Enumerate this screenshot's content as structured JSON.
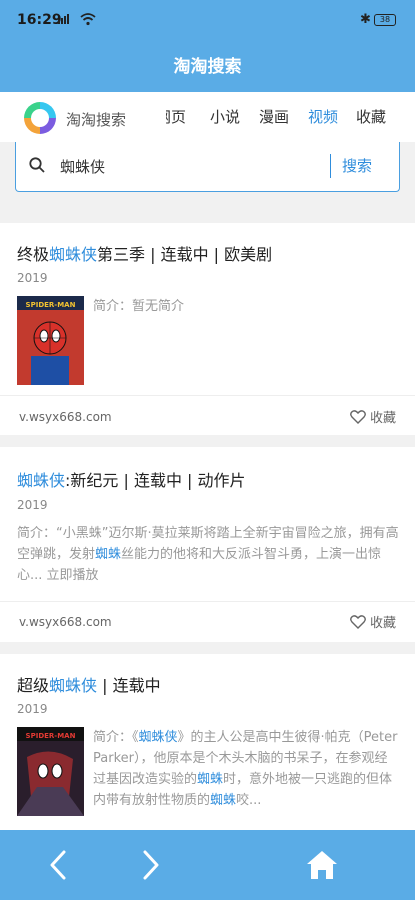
{
  "status_bar": {
    "time": "16:29",
    "battery": "38"
  },
  "header": {
    "title": "淘淘搜索"
  },
  "nav": {
    "logo_text": "淘淘搜索",
    "tabs": [
      {
        "label": "网页",
        "active": false
      },
      {
        "label": "小说",
        "active": false
      },
      {
        "label": "漫画",
        "active": false
      },
      {
        "label": "视频",
        "active": true
      },
      {
        "label": "收藏",
        "active": false
      }
    ]
  },
  "search": {
    "value": "蜘蛛侠",
    "button_label": "搜索"
  },
  "results": [
    {
      "title_hl": "终极",
      "title_key": "蜘蛛侠",
      "title_rest": "第三季 | 连载中 | 欧美剧",
      "year": "2019",
      "desc_a": "简介：暂无简介",
      "source": "v.wsyx668.com",
      "fav_label": "收藏"
    },
    {
      "title_key": "蜘蛛侠",
      "title_rest": ":新纪元 | 连载中 | 动作片",
      "year": "2019",
      "desc_a": "简介：“小黑蛛”迈尔斯·莫拉莱斯将踏上全新宇宙冒险之旅，拥有高空弹跳，发射",
      "desc_b": "蜘蛛",
      "desc_c": "丝能力的他将和大反派斗智斗勇，上演一出惊心... 立即播放",
      "source": "v.wsyx668.com",
      "fav_label": "收藏"
    },
    {
      "title_hl": "超级",
      "title_key": "蜘蛛侠",
      "title_rest": " | 连载中",
      "year": "2019",
      "desc_a": "简介：《",
      "desc_b": "蜘蛛侠",
      "desc_c": "》的主人公是高中生彼得·帕克（Peter Parker），他原本是个木头木脑的书呆子，在参观经过基因改造实验的",
      "desc_d": "蜘蛛",
      "desc_e": "时，意外地被一只逃跑的但体内带有放射性物质的",
      "desc_f": "蜘蛛",
      "desc_g": "咬..."
    }
  ],
  "poster_1_text": "SPIDER-MAN",
  "poster_3_text": "SPIDER-MAN",
  "colors": {
    "primary": "#5aace6",
    "accent": "#2f8ddc"
  }
}
